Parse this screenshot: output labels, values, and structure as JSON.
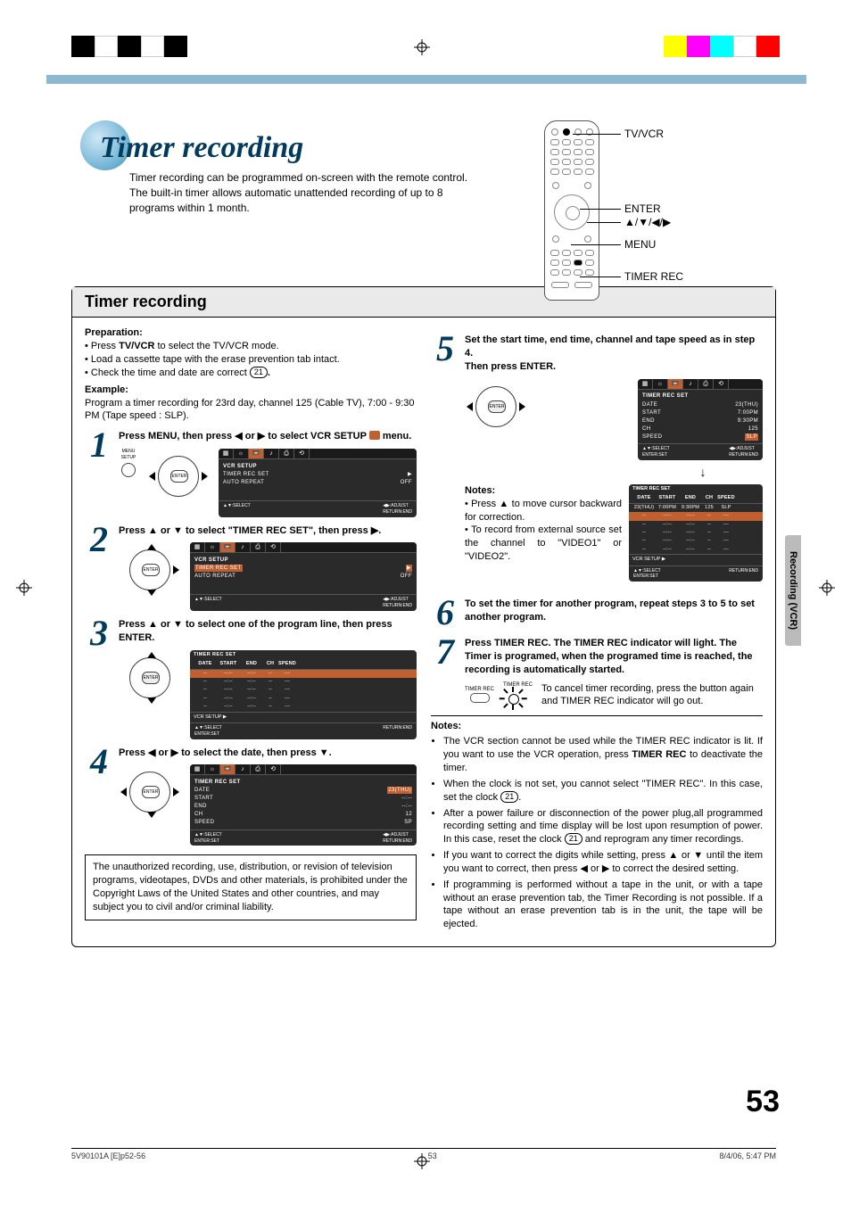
{
  "header": {
    "title": "Timer recording",
    "intro": "Timer recording can be programmed on-screen with the remote control. The built-in timer allows automatic unattended recording of up to 8 programs within 1 month."
  },
  "remote_labels": {
    "tvvcr": "TV/VCR",
    "enter": "ENTER",
    "arrows": "▲/▼/◀/▶",
    "menu": "MENU",
    "timer_rec": "TIMER REC"
  },
  "section_title": "Timer recording",
  "prep": {
    "heading": "Preparation:",
    "b1a": "• Press ",
    "b1b": "TV/VCR",
    "b1c": " to select the TV/VCR mode.",
    "b2": "• Load a cassette tape with the erase prevention tab intact.",
    "b3a": "• Check the time and date are correct ",
    "b3_ref": "21",
    "b3c": ".",
    "example_h": "Example:",
    "example": "Program a timer recording for 23rd day, channel 125 (Cable TV), 7:00 - 9:30 PM (Tape speed : SLP)."
  },
  "steps": {
    "s1": {
      "num": "1",
      "text_a": "Press MENU, then press ◀ or ▶ to select VCR SETUP ",
      "text_b": " menu."
    },
    "s2": {
      "num": "2",
      "text": "Press ▲ or ▼ to select \"TIMER REC SET\", then press ▶."
    },
    "s3": {
      "num": "3",
      "text": "Press ▲ or ▼ to select one of the program line, then press ENTER."
    },
    "s4": {
      "num": "4",
      "text": "Press ◀ or ▶ to select the date, then press ▼."
    },
    "s5": {
      "num": "5",
      "text": "Set the start time, end time, channel and tape speed as in step 4.",
      "text2": "Then press ENTER.",
      "notes_h": "Notes:",
      "n1": "• Press ▲ to move cursor backward for correction.",
      "n2": "• To record from external source set the channel to \"VIDEO1\" or \"VIDEO2\"."
    },
    "s6": {
      "num": "6",
      "text": "To set the timer for another program, repeat steps 3 to 5 to set another program."
    },
    "s7": {
      "num": "7",
      "text": "Press TIMER REC. The TIMER REC indicator will light. The Timer is programed, when the programed time is reached, the recording is automatically started.",
      "cancel": "To cancel timer recording, press the button again and TIMER REC indicator will go out.",
      "btn_label": "TIMER REC"
    }
  },
  "osd": {
    "vcr_setup_title": "VCR SETUP",
    "timer_rec_set_title": "TIMER REC SET",
    "auto_repeat": "AUTO REPEAT",
    "off": "OFF",
    "select": "▲▼:SELECT",
    "adjust": "◀▶:ADJUST",
    "select2": "◀▶:SELECT",
    "enter_set": "ENTER:SET",
    "return": "RETURN:END",
    "date": "DATE",
    "start": "START",
    "end": "END",
    "ch": "CH",
    "speed": "SPEED",
    "spend": "SPEND",
    "s4_date": "23(THU)",
    "s4_start": "--:--",
    "s4_end": "--:--",
    "s4_sp": "SP",
    "s4_ch": "12",
    "s5_date": "23(THU)",
    "s5_start": "7:00PM",
    "s5_end": "9:30PM",
    "s5_ch": "125",
    "s5_sp": "SLP",
    "vcr_setup_arrow": "VCR SETUP   ▶",
    "blank": "--",
    "blanktime": "--:--",
    "blankdate": "--/--",
    "blanksp": "---"
  },
  "disclaimer": "The unauthorized recording, use, distribution, or revision of television programs, videotapes, DVDs and other materials, is prohibited under the Copyright Laws of the United States and other countries, and may subject you to civil and/or criminal liability.",
  "notes2": {
    "heading": "Notes:",
    "n1a": "The VCR section cannot be used while the TIMER REC indicator is lit. If you want to use the VCR operation, press ",
    "n1b": "TIMER REC",
    "n1c": " to deactivate the timer.",
    "n2a": "When the clock is not set, you cannot select \"TIMER REC\". In this case, set the clock ",
    "n2_ref": "21",
    "n2c": ".",
    "n3a": "After a power failure or disconnection of the power plug,all programmed recording setting and time display will be  lost upon resumption of power. In this case, reset the clock ",
    "n3_ref": "21",
    "n3c": " and reprogram any timer recordings.",
    "n4": "If you want to correct the digits while setting, press ▲ or ▼ until the item you want to correct, then press ◀ or ▶ to correct the desired setting.",
    "n5": "If programming is performed without a tape in the unit, or with a tape without an erase prevention tab, the Timer Recording is not possible. If a tape without an erase prevention tab is in the unit, the tape will be ejected."
  },
  "side_tab": "Recording (VCR)",
  "page_num": "53",
  "footer": {
    "left": "5V90101A [E]p52-56",
    "mid": "53",
    "right": "8/4/06, 5:47 PM"
  },
  "menu_setup_label": "MENU SETUP",
  "enter_label": "ENTER",
  "timer_rec_label": "TIMER REC"
}
